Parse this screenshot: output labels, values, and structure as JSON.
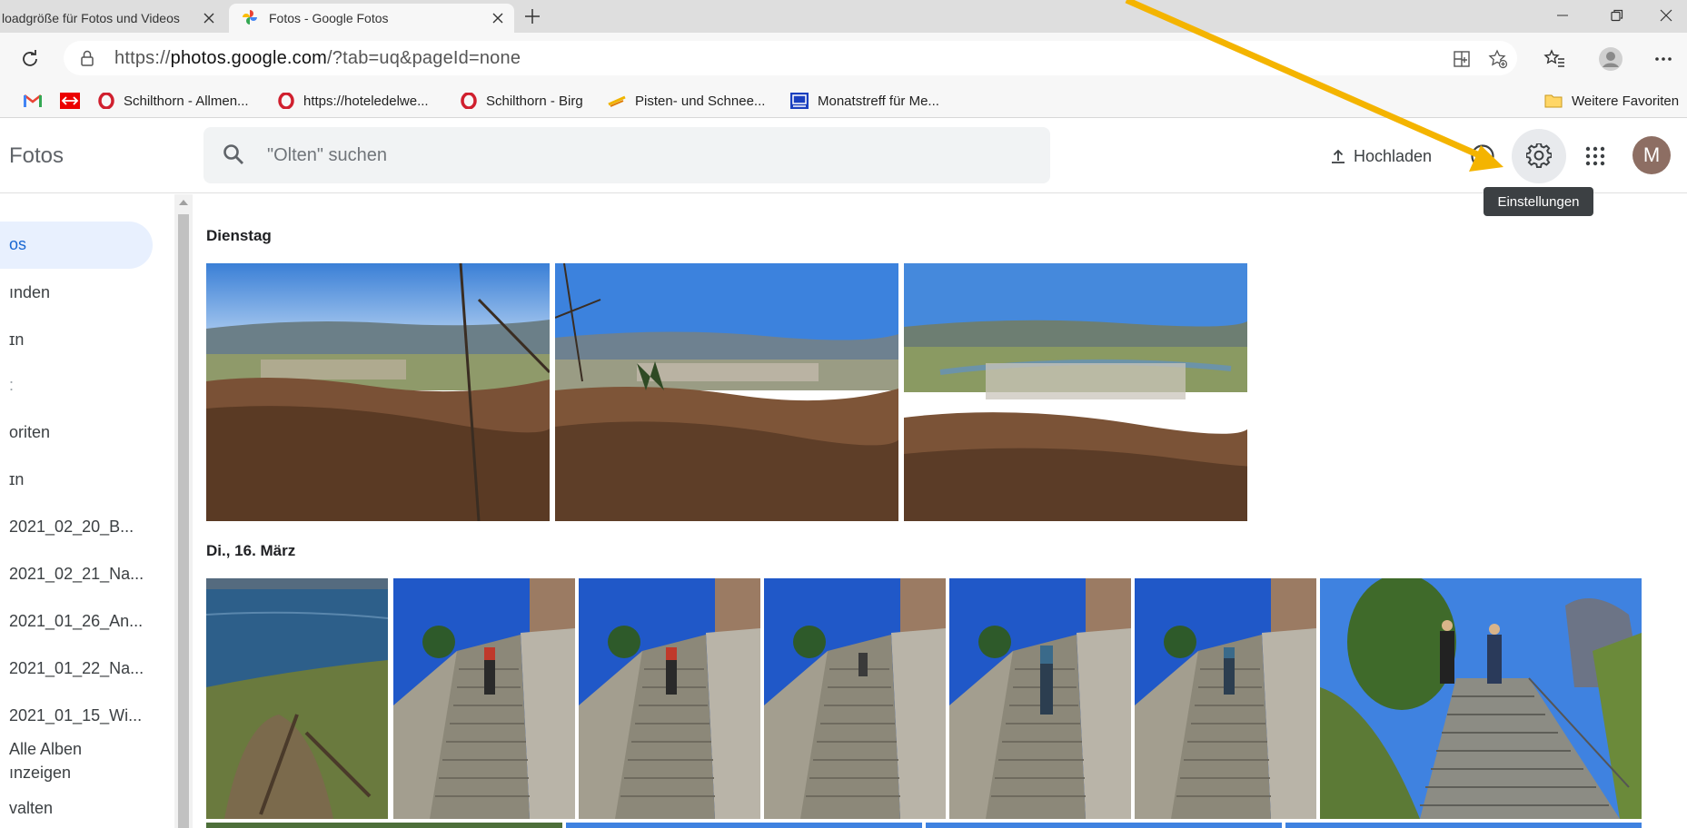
{
  "browser": {
    "tabs": [
      {
        "title": "loadgröße für Fotos und Videos",
        "favicon": "google-photos-icon",
        "active": false
      },
      {
        "title": "Fotos - Google Fotos",
        "favicon": "google-photos-icon",
        "active": true
      }
    ],
    "address": {
      "prefix": "https://",
      "host": "photos.google.com",
      "path": "/?tab=uq&pageId=none"
    },
    "bookmarks": [
      {
        "label": "",
        "icon": "gmail-icon"
      },
      {
        "label": "",
        "icon": "sbb-icon"
      },
      {
        "label": "Schilthorn - Allmen...",
        "icon": "opera-icon"
      },
      {
        "label": "https://hoteledelwe...",
        "icon": "opera-icon"
      },
      {
        "label": "Schilthorn - Birg",
        "icon": "opera-icon"
      },
      {
        "label": "Pisten- und Schnee...",
        "icon": "ski-icon"
      },
      {
        "label": "Monatstreff für Me...",
        "icon": "site-icon"
      }
    ],
    "other_favorites": "Weitere Favoriten"
  },
  "app": {
    "title": "Fotos",
    "search_placeholder": "\"Olten\" suchen",
    "upload_label": "Hochladen",
    "settings_tooltip": "Einstellungen",
    "avatar_letter": "M"
  },
  "sidebar": {
    "items": [
      {
        "label": "os",
        "active": true
      },
      {
        "label": "ınden"
      },
      {
        "label": "ɪn"
      },
      {
        "label": ":"
      },
      {
        "label": "oriten"
      },
      {
        "label": "ɪn"
      },
      {
        "label": "2021_02_20_B..."
      },
      {
        "label": "2021_02_21_Na..."
      },
      {
        "label": "2021_01_26_An..."
      },
      {
        "label": "2021_01_22_Na..."
      },
      {
        "label": "2021_01_15_Wi..."
      },
      {
        "label": "Alle Alben"
      },
      {
        "label": "ınzeigen"
      },
      {
        "label": "valten"
      }
    ]
  },
  "main": {
    "sections": [
      {
        "date": "Dienstag",
        "photo_count": 3
      },
      {
        "date": "Di., 16. März",
        "photo_count": 7
      }
    ]
  },
  "colors": {
    "accent_blue": "#1a73e8",
    "annotation_arrow": "#f4b400",
    "avatar": "#8d6e63"
  }
}
